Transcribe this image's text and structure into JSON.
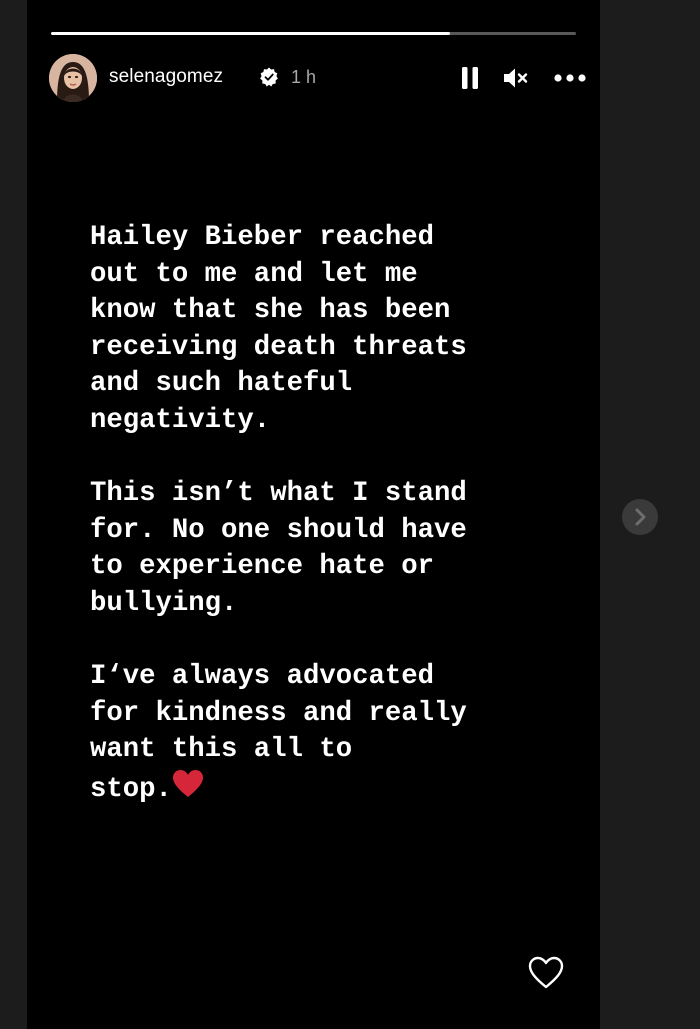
{
  "story": {
    "progress_fraction": 0.76,
    "account": {
      "username": "selenagomez",
      "time_ago": "1 h",
      "verified": true
    },
    "controls": {
      "pause_icon": "pause-icon",
      "mute_icon": "muted-speaker-icon",
      "more_icon": "more-options-icon"
    },
    "text_paragraphs": [
      "Hailey Bieber reached\nout to me and let me\nknow that she has been\nreceiving death threats\nand such hateful\nnegativity.",
      "This isn’t what I stand\nfor. No one should have\nto experience hate or\nbullying.",
      "I‘ve always advocated\nfor kindness and really\nwant this all to\nstop."
    ],
    "ending_emoji": "red-heart-emoji",
    "like_icon": "heart-outline-icon",
    "next_icon": "chevron-right-icon"
  },
  "colors": {
    "backdrop": "#1c1c1c",
    "story_background": "#000000",
    "text": "#ffffff",
    "secondary_text": "#a8a8a8",
    "heart_red": "#d6263a",
    "verified_badge": "#ffffff"
  }
}
